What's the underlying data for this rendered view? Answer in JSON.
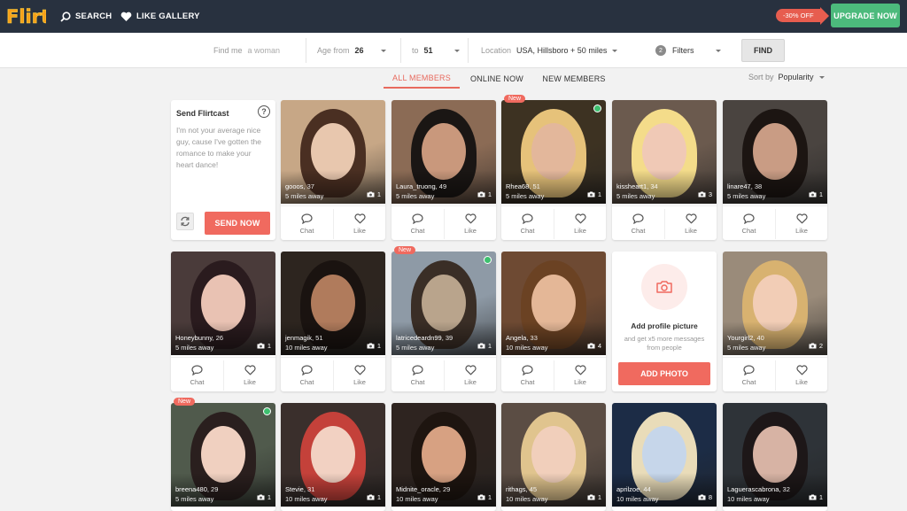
{
  "header": {
    "logo": "Flirt",
    "nav": {
      "search": "SEARCH",
      "like_gallery": "LIKE GALLERY"
    },
    "promo": "-30% OFF",
    "upgrade": "UPGRADE NOW"
  },
  "search": {
    "find_me_label": "Find me",
    "find_me_value": "a woman",
    "age_from_label": "Age from",
    "age_from_value": "26",
    "age_to_label": "to",
    "age_to_value": "51",
    "location_label": "Location",
    "location_value": "USA, Hillsboro + 50 miles",
    "filters_count": "2",
    "filters_label": "Filters",
    "find_button": "FIND"
  },
  "tabs": [
    {
      "label": "ALL MEMBERS",
      "active": true
    },
    {
      "label": "ONLINE NOW",
      "active": false
    },
    {
      "label": "NEW MEMBERS",
      "active": false
    }
  ],
  "sort": {
    "label": "Sort by",
    "value": "Popularity"
  },
  "flirtcast": {
    "title": "Send Flirtcast",
    "message": "I'm not your average nice guy, cause I've gotten the romance to make your heart dance!",
    "send_button": "SEND NOW"
  },
  "action_labels": {
    "chat": "Chat",
    "like": "Like"
  },
  "add_photo": {
    "title": "Add profile picture",
    "subtitle": "and get x5 more messages from people",
    "button": "ADD PHOTO"
  },
  "badge_new": "New",
  "members": [
    {
      "name": "gooos",
      "age": ", 37",
      "distance": "5 miles away",
      "photos": "1",
      "new": false,
      "online": false
    },
    {
      "name": "Laura_truong",
      "age": ", 49",
      "distance": "5 miles away",
      "photos": "1",
      "new": false,
      "online": false
    },
    {
      "name": "Rhea68",
      "age": ", 51",
      "distance": "5 miles away",
      "photos": "1",
      "new": true,
      "online": true
    },
    {
      "name": "kissheart1",
      "age": ", 34",
      "distance": "5 miles away",
      "photos": "3",
      "new": false,
      "online": false
    },
    {
      "name": "linare47",
      "age": ", 38",
      "distance": "5 miles away",
      "photos": "1",
      "new": false,
      "online": false
    },
    {
      "name": "Honeybunny",
      "age": ", 26",
      "distance": "5 miles away",
      "photos": "1",
      "new": false,
      "online": false
    },
    {
      "name": "jenmagik",
      "age": ", 51",
      "distance": "10 miles away",
      "photos": "1",
      "new": false,
      "online": false
    },
    {
      "name": "latricedeardn99",
      "age": ", 39",
      "distance": "5 miles away",
      "photos": "1",
      "new": true,
      "online": true
    },
    {
      "name": "Angela",
      "age": ", 33",
      "distance": "10 miles away",
      "photos": "4",
      "new": false,
      "online": false
    },
    {
      "name": "Yourgirl2",
      "age": ", 40",
      "distance": "5 miles away",
      "photos": "2",
      "new": false,
      "online": false
    },
    {
      "name": "breena480",
      "age": ", 29",
      "distance": "5 miles away",
      "photos": "1",
      "new": true,
      "online": true
    },
    {
      "name": "Stevie",
      "age": ", 31",
      "distance": "10 miles away",
      "photos": "1",
      "new": false,
      "online": false
    },
    {
      "name": "Midnite_oracle",
      "age": ", 29",
      "distance": "10 miles away",
      "photos": "1",
      "new": false,
      "online": false
    },
    {
      "name": "rithags",
      "age": ", 45",
      "distance": "10 miles away",
      "photos": "1",
      "new": false,
      "online": false
    },
    {
      "name": "aprilzoe",
      "age": ", 44",
      "distance": "10 miles away",
      "photos": "8",
      "new": false,
      "online": false
    },
    {
      "name": "Laguerascabrona",
      "age": ", 32",
      "distance": "10 miles away",
      "photos": "1",
      "new": false,
      "online": false
    }
  ]
}
